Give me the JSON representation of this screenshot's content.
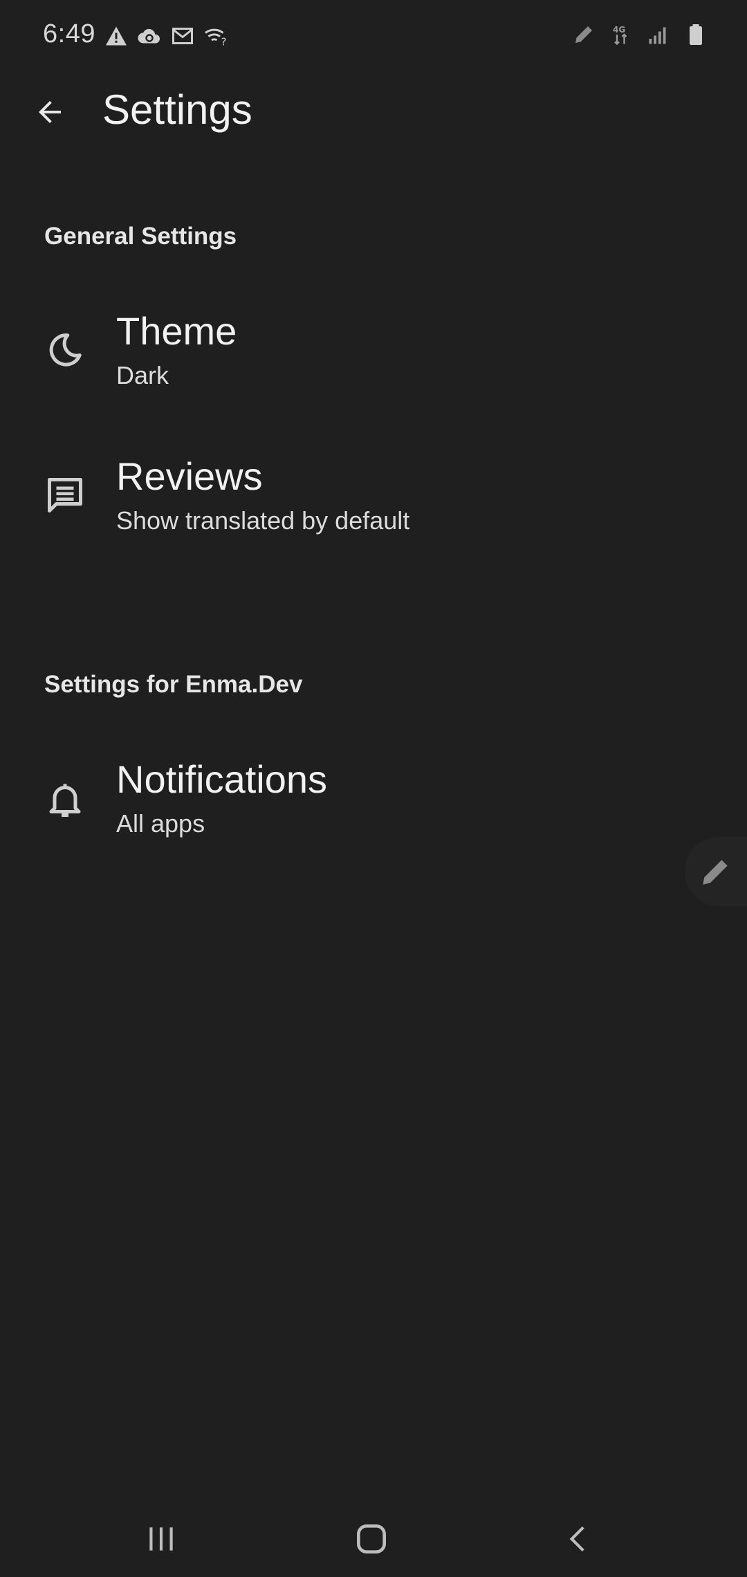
{
  "status_bar": {
    "time": "6:49",
    "left_icons": [
      "alert-icon",
      "cloud-sync-icon",
      "gmail-icon",
      "wifi-question-icon"
    ],
    "right_icons": [
      "pen-icon",
      "4g-lte-icon",
      "signal-icon",
      "battery-icon"
    ]
  },
  "app_bar": {
    "title": "Settings"
  },
  "sections": [
    {
      "header": "General Settings",
      "items": [
        {
          "icon": "moon-icon",
          "title": "Theme",
          "summary": "Dark"
        },
        {
          "icon": "message-icon",
          "title": "Reviews",
          "summary": "Show translated by default"
        }
      ]
    },
    {
      "header": "Settings for Enma.Dev",
      "items": [
        {
          "icon": "bell-icon",
          "title": "Notifications",
          "summary": "All apps"
        }
      ]
    }
  ],
  "nav_bar": {
    "buttons": [
      "recent-apps-icon",
      "home-icon",
      "back-icon"
    ]
  },
  "colors": {
    "background": "#1f1f1f",
    "text_primary": "#f2f2f2",
    "icon": "#cfcfcf"
  }
}
